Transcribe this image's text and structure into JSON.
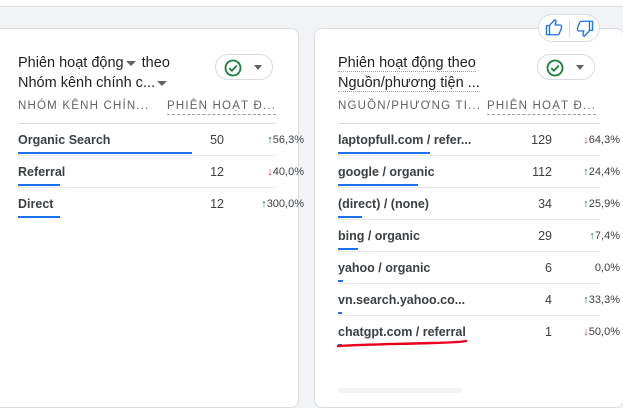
{
  "left_card": {
    "title_line1": "Phiên hoạt động",
    "title_line1_suffix": "theo",
    "title_line2": "Nhóm kênh chính c...",
    "col_dim": "NHÓM KÊNH CHÍN...",
    "col_metric": "PHIÊN HOẠT Đ...",
    "rows": [
      {
        "label": "Organic Search",
        "value": "50",
        "change": "56,3%",
        "dir": "up",
        "share": 1.0
      },
      {
        "label": "Referral",
        "value": "12",
        "change": "40,0%",
        "dir": "down",
        "share": 0.24
      },
      {
        "label": "Direct",
        "value": "12",
        "change": "300,0%",
        "dir": "up",
        "share": 0.24
      }
    ]
  },
  "right_card": {
    "title_line1": "Phiên hoạt động theo",
    "title_line2": "Nguồn/phương tiện ...",
    "col_dim": "NGUỒN/PHƯƠNG TI...",
    "col_metric": "PHIÊN HOẠT Đ...",
    "rows": [
      {
        "label": "laptopfull.com / refer...",
        "value": "129",
        "change": "64,3%",
        "dir": "down",
        "share": 1.0
      },
      {
        "label": "google / organic",
        "value": "112",
        "change": "24,4%",
        "dir": "up",
        "share": 0.87
      },
      {
        "label": "(direct) / (none)",
        "value": "34",
        "change": "25,9%",
        "dir": "up",
        "share": 0.26
      },
      {
        "label": "bing / organic",
        "value": "29",
        "change": "7,4%",
        "dir": "up",
        "share": 0.22
      },
      {
        "label": "yahoo / organic",
        "value": "6",
        "change": "0,0%",
        "dir": "none",
        "share": 0.05
      },
      {
        "label": "vn.search.yahoo.co...",
        "value": "4",
        "change": "33,3%",
        "dir": "up",
        "share": 0.03
      },
      {
        "label": "chatgpt.com / referral",
        "value": "1",
        "change": "50,0%",
        "dir": "down",
        "share": 0.01
      }
    ]
  },
  "icons": {
    "status": "check-circle-icon",
    "thumbs_up": "thumbs-up-icon",
    "thumbs_down": "thumbs-down-icon"
  },
  "colors": {
    "accent": "#1a73e8",
    "up": "#188038",
    "down": "#d93025",
    "status_green": "#188038",
    "annotation_red": "#e8001c"
  }
}
